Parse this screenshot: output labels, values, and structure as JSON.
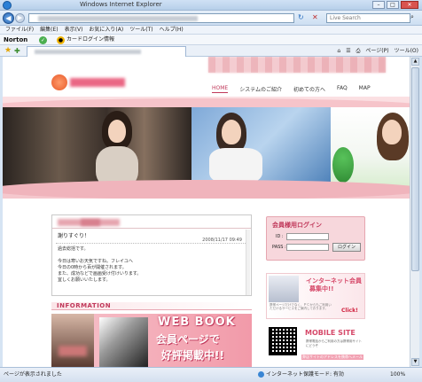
{
  "window": {
    "title": "Windows Internet Explorer"
  },
  "navbar": {
    "search_placeholder": "Live Search"
  },
  "menu": [
    "ファイル(F)",
    "編集(E)",
    "表示(V)",
    "お気に入り(A)",
    "ツール(T)",
    "ヘルプ(H)"
  ],
  "toolbar": {
    "norton": "Norton",
    "card_label": "カードログイン情報"
  },
  "favbar": {
    "page_label": "ページ(P)",
    "tools_label": "ツール(O)"
  },
  "site": {
    "nav": [
      "HOME",
      "システムのご紹介",
      "初めての方へ",
      "FAQ",
      "MAP"
    ],
    "news": {
      "entry_title": "謝りすぐり！",
      "entry_date": "2008/11/17 09:49",
      "body_lines": [
        "過去総括です。",
        "",
        "今日は寒いお天気ですね。フレイユへ",
        "今日の0時から百が開催されます。",
        "また、成功などで画画受け付けいります。",
        "宜しくお願いいたします。"
      ]
    },
    "information_label": "INFORMATION",
    "webbook": {
      "line1": "WEB BOOK",
      "line2": "会員ページで",
      "line3": "好評掲載中!!"
    },
    "login": {
      "title": "会員様用ログイン",
      "id_label": "ID",
      "pass_label": "PASS",
      "button": "ログイン"
    },
    "recruit": {
      "title1": "インターネット会員",
      "title2": "募集中!!",
      "desc": "携帯ページだけでなく、ＰＣからもご利用いただけるサービスをご案内しております。",
      "click": "Click!"
    },
    "mobile": {
      "title": "MOBILE SITE",
      "desc": "携帯電話からご利用の方は携帯用サイトにどうぞ",
      "bar": "弊店サイトのアドレスを携帯へメール"
    }
  },
  "status": {
    "left": "ページが表示されました",
    "zone": "インターネット",
    "protect": "保護モード: 有効",
    "zoom": "100%"
  }
}
